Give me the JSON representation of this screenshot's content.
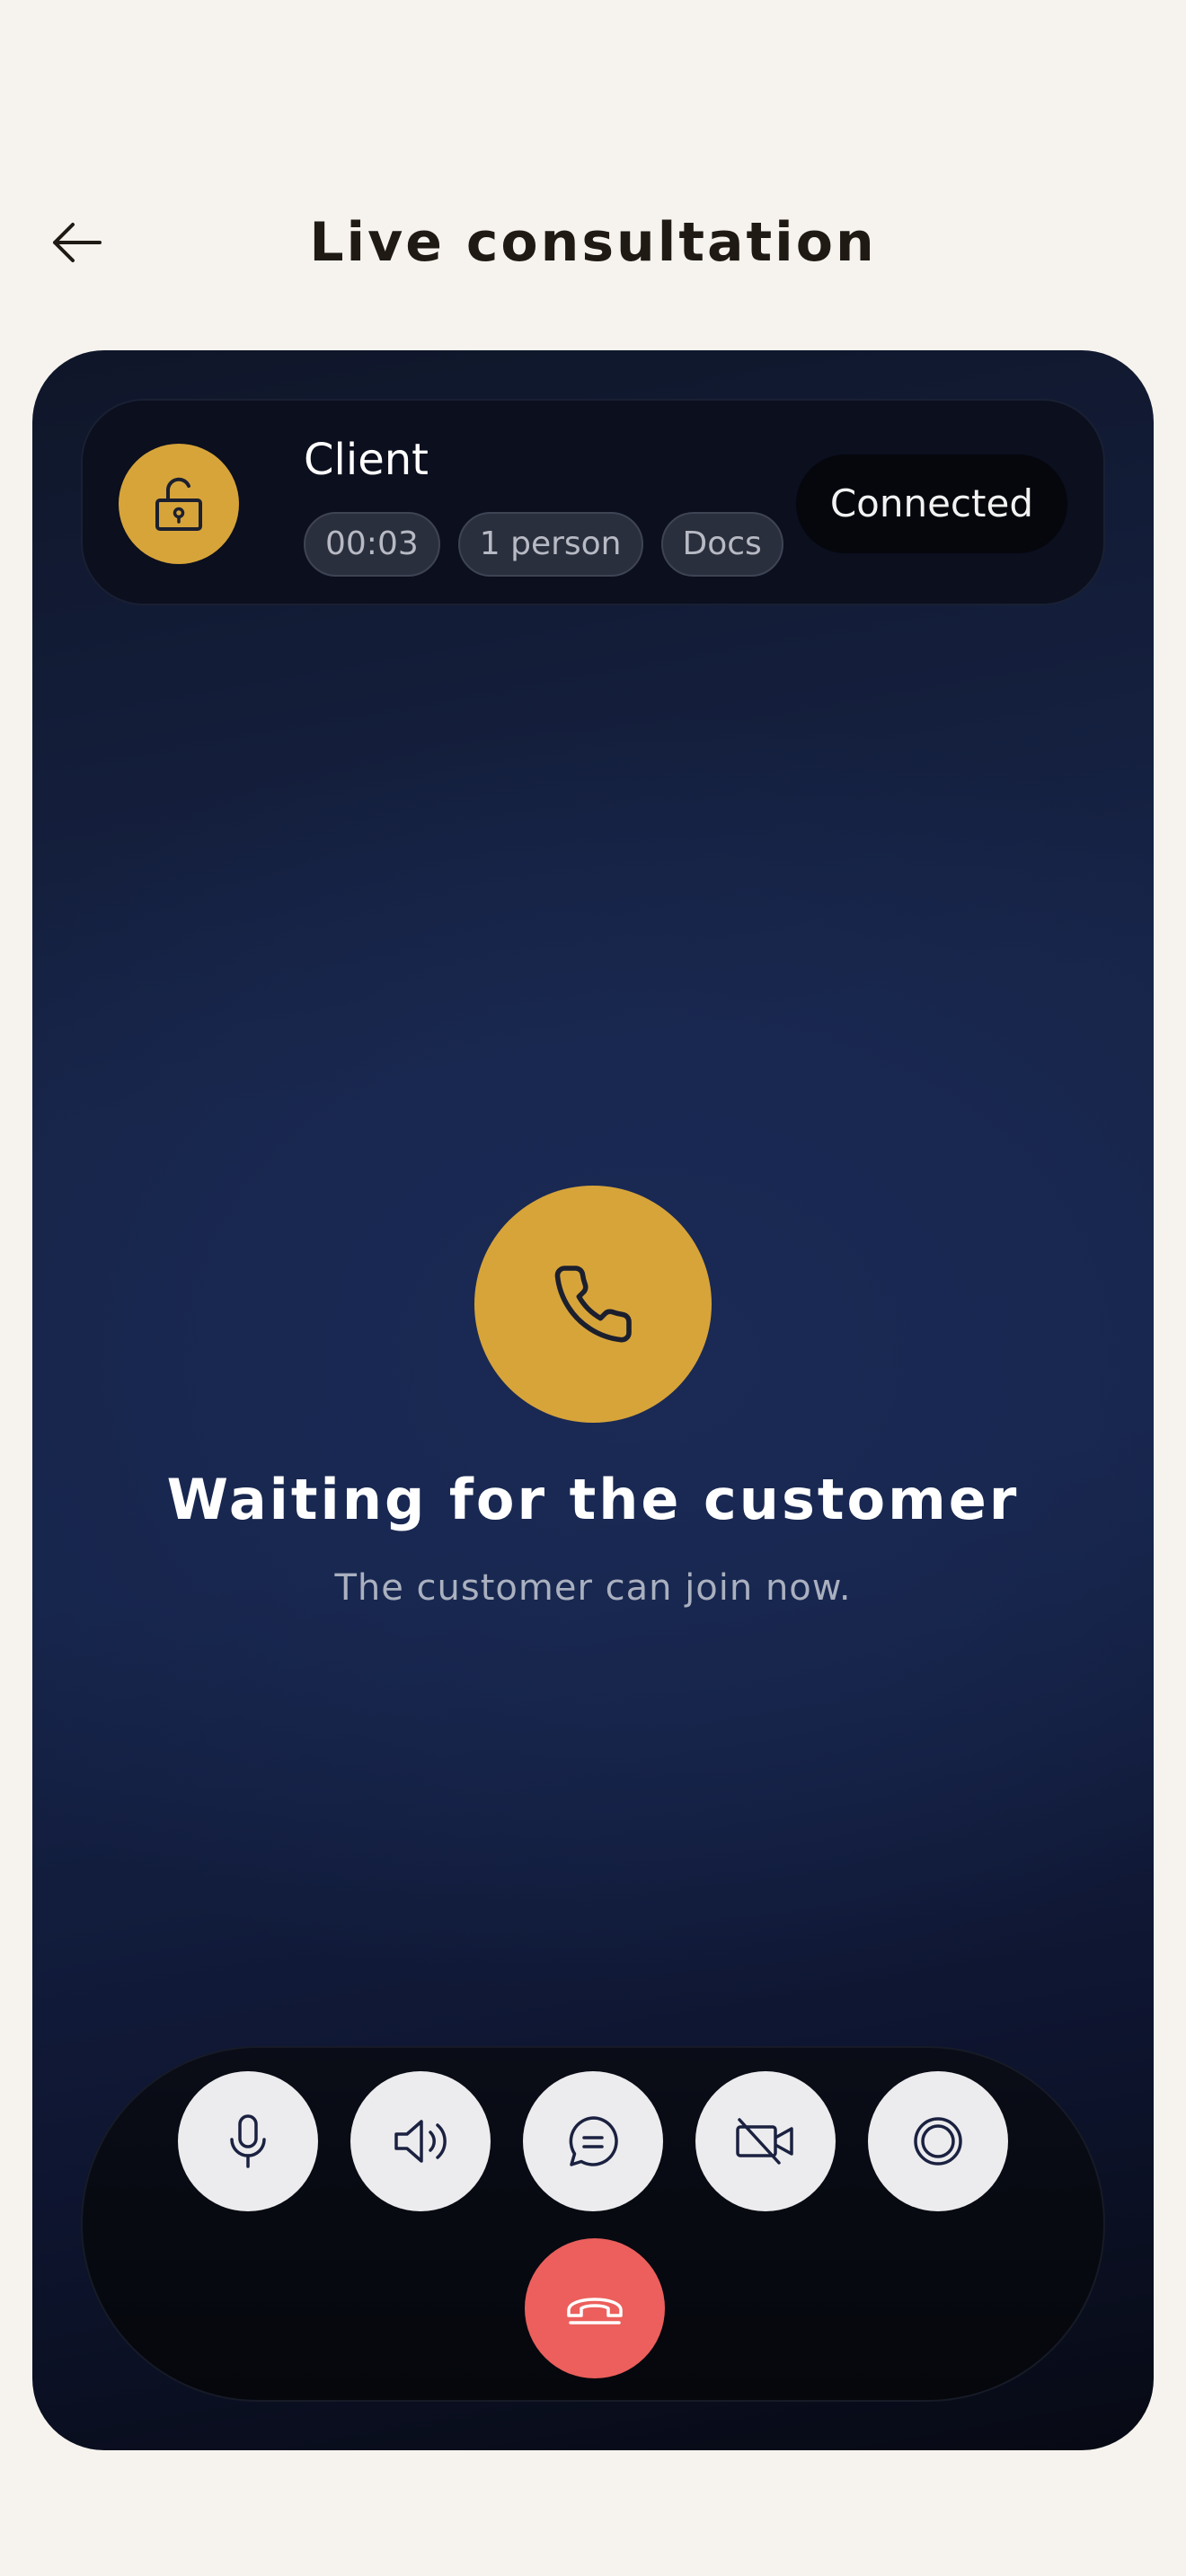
{
  "header": {
    "back_icon": "arrow-left-icon",
    "title": "Live consultation"
  },
  "info_panel": {
    "avatar_icon": "unlocked-padlock-icon",
    "client_name": "Client",
    "chips": [
      "00:03",
      "1 person",
      "Docs"
    ],
    "status": "Connected"
  },
  "center": {
    "icon": "phone-icon",
    "title": "Waiting for the customer",
    "subtitle": "The customer can join now."
  },
  "controls": {
    "buttons": [
      {
        "icon": "microphone-icon"
      },
      {
        "icon": "speaker-icon"
      },
      {
        "icon": "chat-icon"
      },
      {
        "icon": "video-off-icon"
      },
      {
        "icon": "record-icon"
      }
    ],
    "end_call_icon": "hang-up-icon"
  },
  "colors": {
    "background": "#f6f3ee",
    "accent": "#d7a43a",
    "end_call": "#ec5f5c",
    "card_dark": "#0b0f1e",
    "card_blue": "#172448"
  }
}
